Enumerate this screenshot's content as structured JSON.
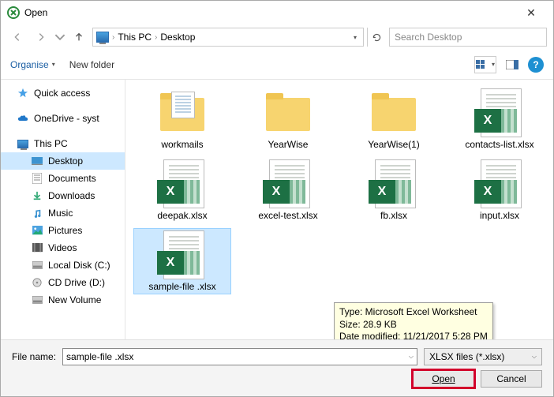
{
  "window": {
    "title": "Open"
  },
  "breadcrumb": {
    "loc1": "This PC",
    "loc2": "Desktop"
  },
  "search": {
    "placeholder": "Search Desktop"
  },
  "toolbar": {
    "organise": "Organise",
    "newfolder": "New folder"
  },
  "sidebar": {
    "quick": "Quick access",
    "onedrive": "OneDrive - syst",
    "thispc": "This PC",
    "desktop": "Desktop",
    "documents": "Documents",
    "downloads": "Downloads",
    "music": "Music",
    "pictures": "Pictures",
    "videos": "Videos",
    "localdisk": "Local Disk (C:)",
    "cddrive": "CD Drive (D:)",
    "newvol": "New Volume"
  },
  "files": {
    "f0": "workmails",
    "f1": "YearWise",
    "f2": "YearWise(1)",
    "f3": "contacts-list.xlsx",
    "f4": "deepak.xlsx",
    "f5": "excel-test.xlsx",
    "f6": "fb.xlsx",
    "f7": "input.xlsx",
    "f8": "sample-file .xlsx"
  },
  "tooltip": {
    "l1": "Type: Microsoft Excel Worksheet",
    "l2": "Size: 28.9 KB",
    "l3": "Date modified: 11/21/2017 5:28 PM"
  },
  "footer": {
    "fname_label": "File name:",
    "fname_value": "sample-file .xlsx",
    "filter": "XLSX files (*.xlsx)",
    "open": "Open",
    "cancel": "Cancel"
  }
}
